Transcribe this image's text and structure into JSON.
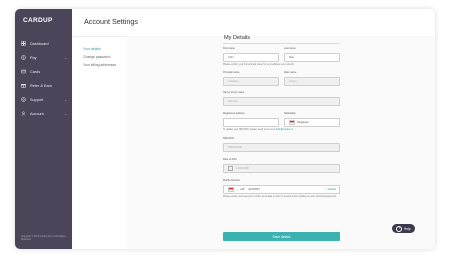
{
  "brand": {
    "logo": "CARDUP"
  },
  "header": {
    "title": "Account Settings"
  },
  "sidebar": {
    "items": [
      {
        "label": "Dashboard",
        "icon": "dashboard-icon",
        "chevron": ""
      },
      {
        "label": "Pay",
        "icon": "pay-icon",
        "chevron": "⌄"
      },
      {
        "label": "Cards",
        "icon": "card-icon",
        "chevron": ""
      },
      {
        "label": "Refer & Earn",
        "icon": "gift-icon",
        "chevron": ""
      },
      {
        "label": "Support",
        "icon": "support-icon",
        "chevron": "⌄"
      },
      {
        "label": "Account",
        "icon": "account-icon",
        "chevron": "⌄"
      }
    ],
    "footer": "Copyright © 2021 CardUp Pte Ltd All Rights Reserved"
  },
  "subnav": {
    "items": [
      {
        "label": "Your details",
        "active": true
      },
      {
        "label": "Change password",
        "active": false
      },
      {
        "label": "Your billing addresses",
        "active": false
      }
    ]
  },
  "form": {
    "section_title": "My Details",
    "first_name": {
      "label": "First name",
      "value": "John"
    },
    "last_name": {
      "label": "Last name",
      "value": "Doe"
    },
    "name_note": "Please confirm your first and last name for us to address you correctly",
    "principal_name": {
      "label": "Principal name",
      "value": "Jonathan"
    },
    "alias_name": {
      "label": "Alias name",
      "value": "Johnny"
    },
    "hanyu_pinyin": {
      "label": "Hanyu pinyin name",
      "value": "Wei Jian"
    },
    "registered_address": {
      "label": "Registered address",
      "value": ""
    },
    "nationality": {
      "label": "Nationality",
      "value": "Singapore",
      "flag": "singapore-flag-icon"
    },
    "update_note": "To update your NRIC/FIN, please reach out to us at",
    "update_email": "hello@cardup.co",
    "nric": {
      "label": "NRIC/FIN",
      "value": "S9812345D"
    },
    "dob": {
      "label": "Date of birth",
      "value": "12/06/1986"
    },
    "mobile": {
      "label": "Mobile Number",
      "flag": "singapore-flag-icon",
      "code": "+65",
      "number": "91234567",
      "status": "✓ Verified"
    },
    "mobile_note": "Please ensure you keep your number up-to-date in order to receive future updates on your upcoming payments",
    "save_label": "Save details"
  },
  "help": {
    "label": "Help",
    "icon": "?"
  },
  "colors": {
    "sidebar": "#4a4558",
    "accent": "#3bb1b1",
    "help": "#3e3a4d"
  }
}
